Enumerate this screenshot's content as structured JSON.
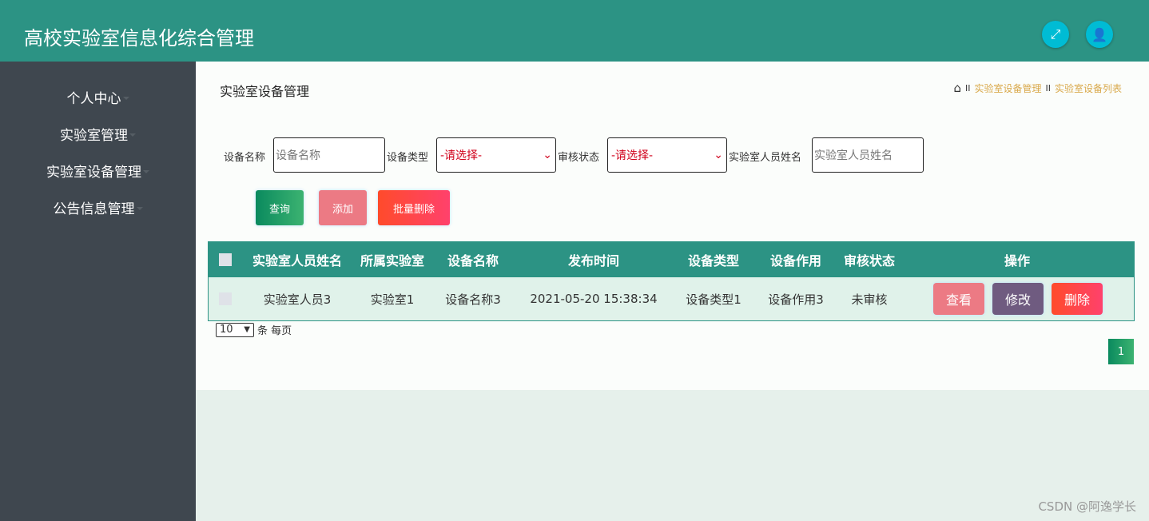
{
  "header": {
    "title": "高校实验室信息化综合管理",
    "icons": [
      "fullscreen-icon",
      "user-icon"
    ]
  },
  "sidebar": {
    "items": [
      {
        "label": "个人中心"
      },
      {
        "label": "实验室管理"
      },
      {
        "label": "实验室设备管理"
      },
      {
        "label": "公告信息管理"
      }
    ]
  },
  "page": {
    "title": "实验室设备管理",
    "breadcrumb": [
      "实验室设备管理",
      "实验室设备列表"
    ],
    "breadcrumb_sep": "II"
  },
  "filters": {
    "name": {
      "label": "设备名称",
      "placeholder": "设备名称"
    },
    "type": {
      "label": "设备类型",
      "value": "-请选择-"
    },
    "status": {
      "label": "审核状态",
      "value": "-请选择-"
    },
    "person": {
      "label": "实验室人员姓名",
      "placeholder": "实验室人员姓名"
    }
  },
  "buttons": {
    "search": "查询",
    "add": "添加",
    "batch_delete": "批量删除"
  },
  "colors": {
    "primary": "#2c9384",
    "sidebar": "#3f474f",
    "accent": "#00bcd4"
  },
  "table": {
    "columns": [
      "实验室人员姓名",
      "所属实验室",
      "设备名称",
      "发布时间",
      "设备类型",
      "设备作用",
      "审核状态",
      "操作"
    ],
    "rows": [
      {
        "person": "实验室人员3",
        "lab": "实验室1",
        "device": "设备名称3",
        "time": "2021-05-20 15:38:34",
        "type": "设备类型1",
        "purpose": "设备作用3",
        "status": "未审核",
        "actions": {
          "view": "查看",
          "edit": "修改",
          "delete": "删除"
        }
      }
    ]
  },
  "pagination": {
    "page_size": "10",
    "per_page_label": "条 每页",
    "current_page": "1"
  },
  "watermark": "CSDN @阿逸学长"
}
